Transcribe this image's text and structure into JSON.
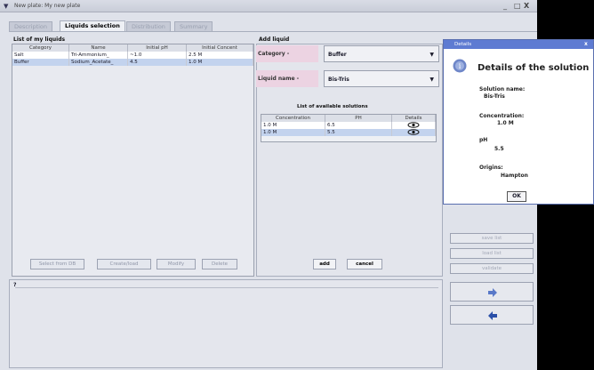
{
  "window": {
    "title": "New plate: My new plate",
    "controls": [
      "_",
      "□",
      "X"
    ]
  },
  "tabs": [
    {
      "label": "Description",
      "active": false
    },
    {
      "label": "Liquids selection",
      "active": true
    },
    {
      "label": "Distribution",
      "active": false
    },
    {
      "label": "Summary",
      "active": false
    }
  ],
  "my_liquids": {
    "title": "List of my liquids",
    "columns": [
      "Category",
      "Name",
      "Initial pH",
      "Initial Concent"
    ],
    "rows": [
      [
        "Salt",
        "Tri-Ammonium_",
        "~1.0",
        "2.5 M"
      ],
      [
        "Buffer",
        "Sodium_Acetate_",
        "4.5",
        "1.0 M"
      ]
    ],
    "buttons": [
      "Select from DB",
      "Create/load",
      "Modify",
      "Delete"
    ]
  },
  "add_liquid": {
    "title": "Add liquid",
    "category_label": "Category -",
    "category_value": "Buffer",
    "liquid_name_label": "Liquid name -",
    "liquid_name_value": "Bis-Tris",
    "solutions_title": "List of available solutions",
    "columns": [
      "Concentration",
      "PH",
      "Details"
    ],
    "rows": [
      [
        "1.0 M",
        "6.5"
      ],
      [
        "1.0 M",
        "5.5"
      ]
    ],
    "add_label": "add",
    "cancel_label": "cancel"
  },
  "notes": {
    "label": "?"
  },
  "side_buttons": [
    "save list",
    "load list",
    "validate"
  ],
  "details_dialog": {
    "title": "Details",
    "heading": "Details of the solution",
    "solution_name_label": "Solution name:",
    "solution_name_value": "Bis-Tris",
    "concentration_label": "Concentration:",
    "concentration_value": "1.0 M",
    "ph_label": "pH",
    "ph_value": "5.5",
    "origin_label": "Origins:",
    "origin_value": "Hampton",
    "ok_label": "OK"
  },
  "colors": {
    "selected_row": "#c3d3ee",
    "dialog_title": "#5e7bd2",
    "label_bg": "#ecd3e2"
  }
}
